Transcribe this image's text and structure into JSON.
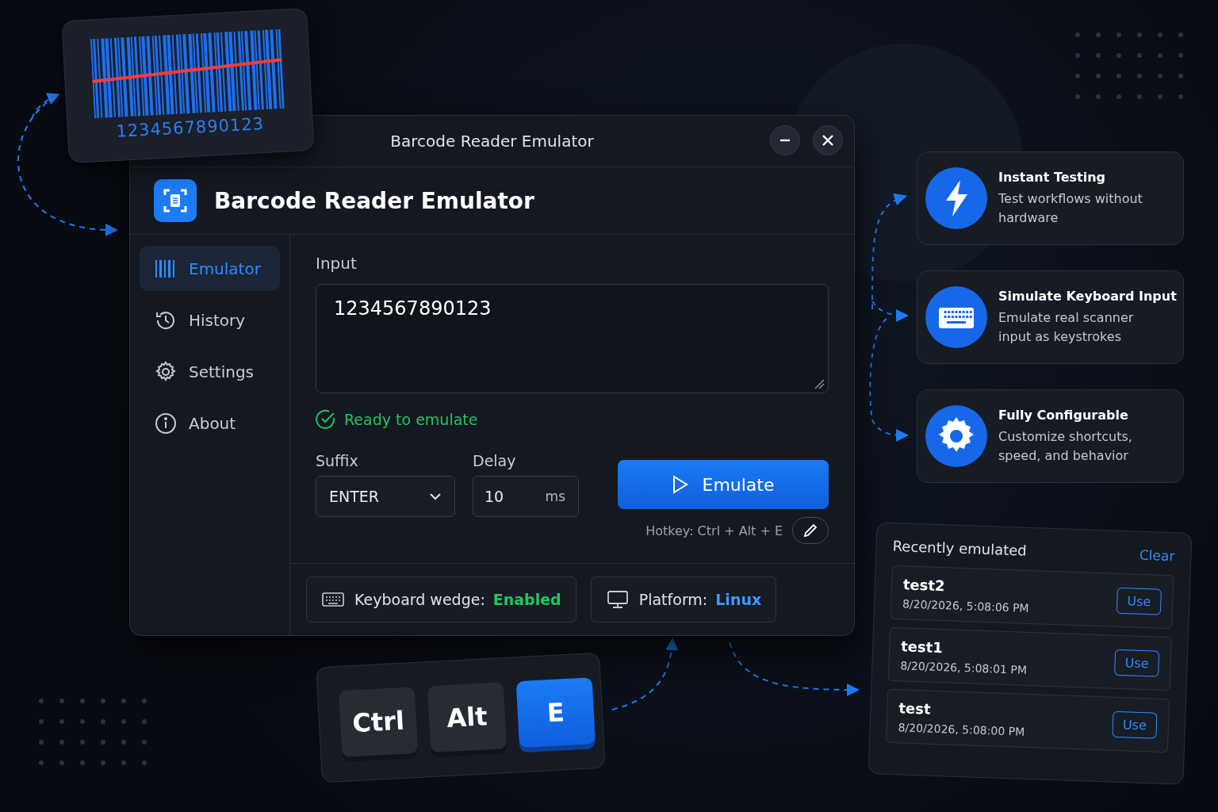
{
  "barcode_card": {
    "digits": "1234567890123"
  },
  "window": {
    "title": "Barcode Reader Emulator",
    "app_title": "Barcode Reader Emulator"
  },
  "sidebar": {
    "items": [
      {
        "label": "Emulator",
        "kind": "barcode",
        "selected": true
      },
      {
        "label": "History",
        "kind": "history",
        "selected": false
      },
      {
        "label": "Settings",
        "kind": "gear",
        "selected": false
      },
      {
        "label": "About",
        "kind": "info",
        "selected": false
      }
    ]
  },
  "input": {
    "label": "Input",
    "value": "1234567890123"
  },
  "status": "Ready to emulate",
  "suffix": {
    "label": "Suffix",
    "value": "ENTER"
  },
  "delay": {
    "label": "Delay",
    "value": "10",
    "unit": "ms"
  },
  "emulate_button": "Emulate",
  "hotkey": "Hotkey: Ctrl + Alt + E",
  "status_bar": [
    {
      "kind": "keyboard",
      "label": "Keyboard wedge:",
      "value": "Enabled",
      "color": "#22c55e"
    },
    {
      "kind": "monitor",
      "label": "Platform:",
      "value": "Linux",
      "color": "#3b9bff"
    }
  ],
  "features": [
    {
      "kind": "bolt",
      "title": "Instant Testing",
      "text": "Test workflows without hardware"
    },
    {
      "kind": "keyboard",
      "title": "Simulate Keyboard Input",
      "text": "Emulate real scanner input as keystrokes"
    },
    {
      "kind": "gear",
      "title": "Fully Configurable",
      "text": "Customize shortcuts, speed, and behavior"
    }
  ],
  "keys": [
    {
      "label": "Ctrl",
      "selected": false
    },
    {
      "label": "Alt",
      "selected": false
    },
    {
      "label": "E",
      "selected": true
    }
  ],
  "recent": {
    "title": "Recently emulated",
    "clear": "Clear",
    "items": [
      {
        "name": "test2",
        "time": "8/20/2026, 5:08:06 PM",
        "button": "Use"
      },
      {
        "name": "test1",
        "time": "8/20/2026, 5:08:01 PM",
        "button": "Use"
      },
      {
        "name": "test",
        "time": "8/20/2026, 5:08:00 PM",
        "button": "Use"
      }
    ]
  }
}
